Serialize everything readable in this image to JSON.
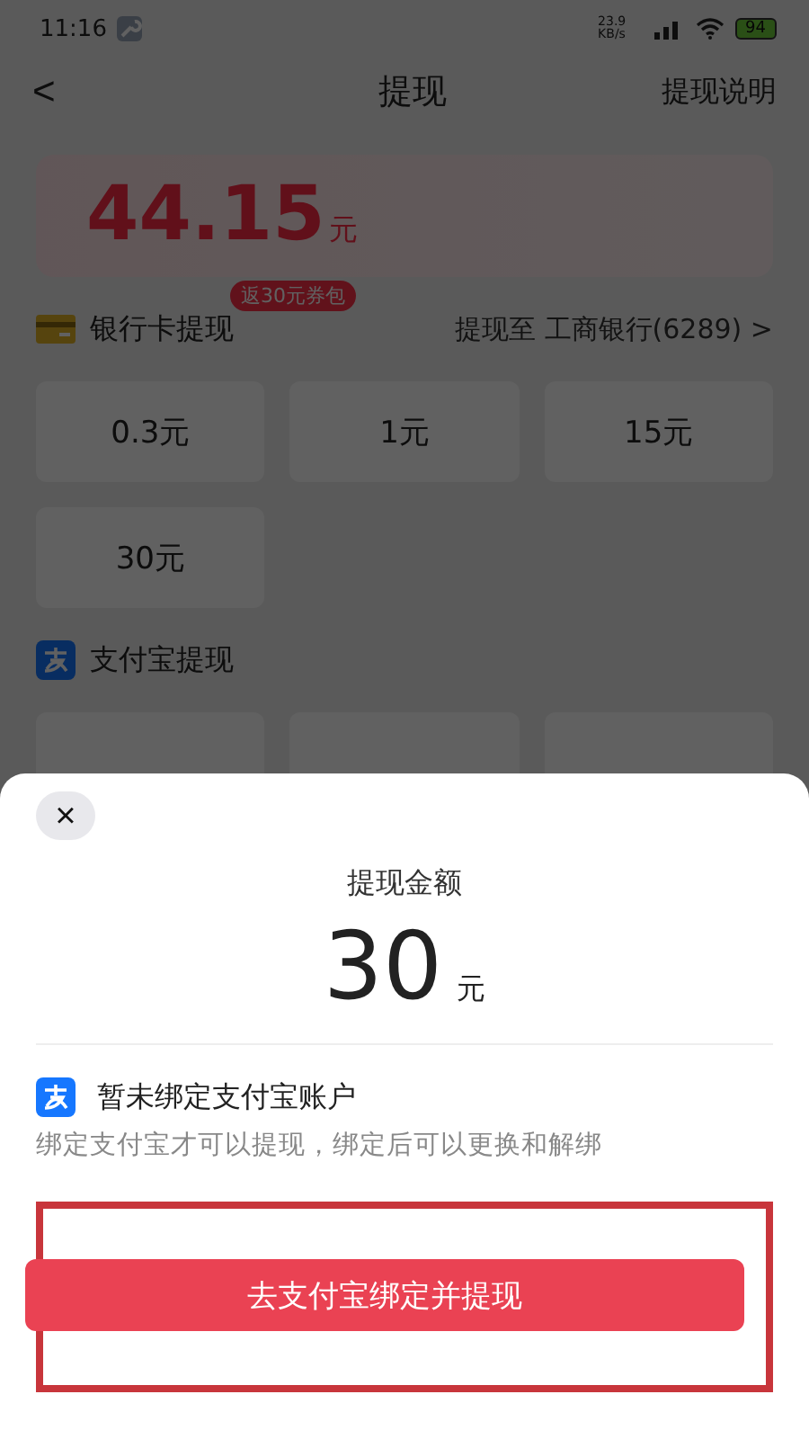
{
  "status_bar": {
    "time": "11:16",
    "speed": "23.9 KB/s",
    "battery": "94"
  },
  "header": {
    "back": "<",
    "title": "提现",
    "action": "提现说明"
  },
  "balance": {
    "amount": "44.15",
    "unit": "元"
  },
  "sections": [
    {
      "kind": "bank",
      "title": "银行卡提现",
      "badge": "返30元券包",
      "destination": "提现至 工商银行(6289)",
      "chevron": ">",
      "options": [
        "0.3元",
        "1元",
        "15元",
        "30元"
      ]
    },
    {
      "kind": "alipay",
      "title": "支付宝提现"
    }
  ],
  "sheet": {
    "close": "×",
    "label": "提现金额",
    "amount": "30",
    "unit": "元",
    "account_title": "暂未绑定支付宝账户",
    "account_note": "绑定支付宝才可以提现，绑定后可以更换和解绑",
    "button": "去支付宝绑定并提现",
    "highlighted": true
  }
}
